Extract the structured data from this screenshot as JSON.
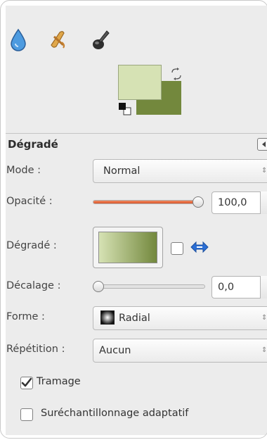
{
  "toolbox": {
    "tools": [
      {
        "icon": "ink-drop-icon"
      },
      {
        "icon": "smudge-icon"
      },
      {
        "icon": "ink-pen-icon"
      }
    ],
    "colors": {
      "foreground": "#d6e2b4",
      "background": "#73883d"
    }
  },
  "options": {
    "title": "Dégradé",
    "mode": {
      "label": "Mode :",
      "value": "Normal"
    },
    "opacity": {
      "label": "Opacité :",
      "value": "100,0",
      "level": 1.0
    },
    "gradient": {
      "label": "Dégradé :",
      "reverse_checked": false
    },
    "offset": {
      "label": "Décalage :",
      "value": "0,0",
      "level": 0.0
    },
    "shape": {
      "label": "Forme :",
      "value": "Radial"
    },
    "repeat": {
      "label": "Répétition :",
      "value": "Aucun"
    },
    "dithering": {
      "label": "Tramage",
      "checked": true
    },
    "supersampling": {
      "label": "Suréchantillonnage adaptatif",
      "checked": false
    }
  },
  "accent": {
    "slider": "#e0683b",
    "swap_arrows": "#2b6fd6"
  }
}
